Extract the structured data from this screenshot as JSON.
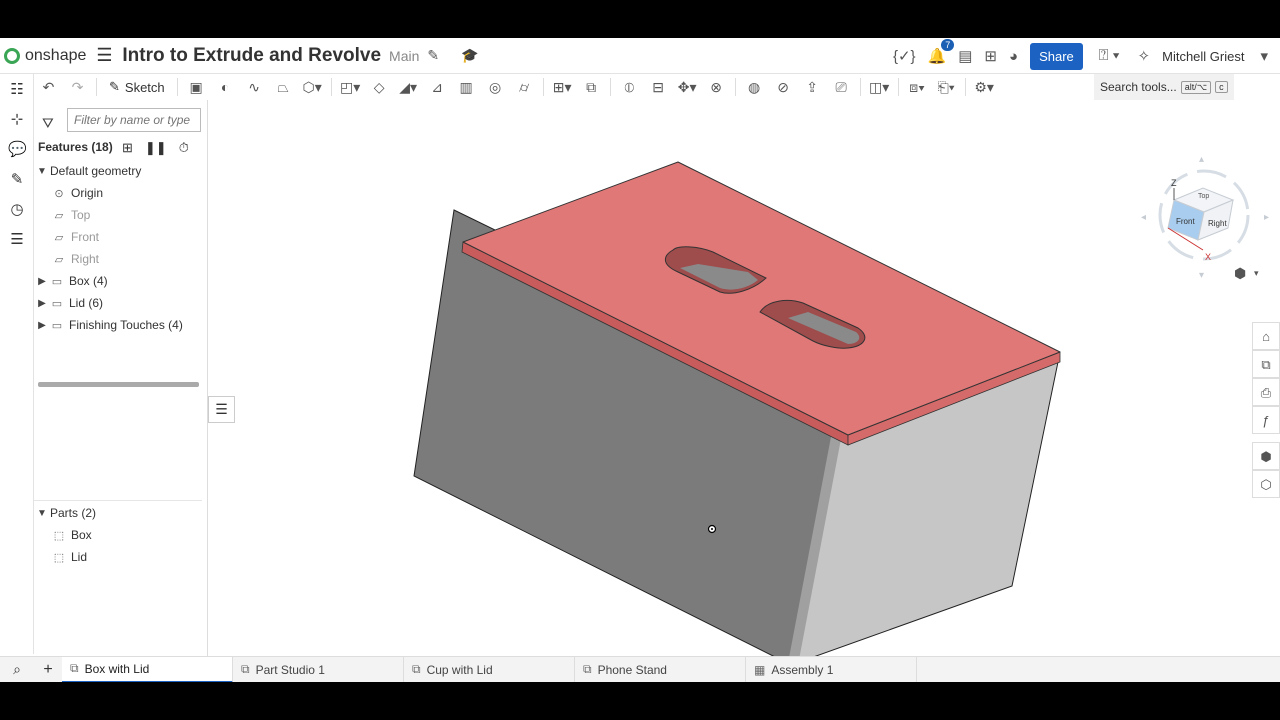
{
  "header": {
    "app_name": "onshape",
    "document_title": "Intro to Extrude and Revolve",
    "branch": "Main",
    "notification_count": "7",
    "share_label": "Share",
    "help_label": "?",
    "user_name": "Mitchell Griest"
  },
  "toolbar": {
    "sketch_label": "Sketch",
    "search_label": "Search tools...",
    "shortcut_modifier": "alt/⌥",
    "shortcut_key": "c"
  },
  "feature_panel": {
    "filter_placeholder": "Filter by name or type",
    "features_header": "Features (18)",
    "tree": [
      {
        "label": "Default geometry",
        "type": "group-open"
      },
      {
        "label": "Origin",
        "type": "origin"
      },
      {
        "label": "Top",
        "type": "plane"
      },
      {
        "label": "Front",
        "type": "plane"
      },
      {
        "label": "Right",
        "type": "plane"
      },
      {
        "label": "Box (4)",
        "type": "folder"
      },
      {
        "label": "Lid (6)",
        "type": "folder"
      },
      {
        "label": "Finishing Touches (4)",
        "type": "folder"
      }
    ],
    "parts_header": "Parts (2)",
    "parts": [
      "Box",
      "Lid"
    ]
  },
  "view_cube": {
    "top_label": "Top",
    "front_label": "Front",
    "right_label": "Right",
    "axis_x": "X",
    "axis_z": "Z"
  },
  "tabs": [
    {
      "label": "Box with Lid",
      "active": true,
      "icon": "part-studio-icon"
    },
    {
      "label": "Part Studio 1",
      "active": false,
      "icon": "part-studio-icon"
    },
    {
      "label": "Cup with Lid",
      "active": false,
      "icon": "part-studio-icon"
    },
    {
      "label": "Phone Stand",
      "active": false,
      "icon": "part-studio-icon"
    },
    {
      "label": "Assembly 1",
      "active": false,
      "icon": "assembly-icon"
    }
  ],
  "colors": {
    "lid_face": "#e07878",
    "box_front": "#7a7a7a",
    "box_side": "#c4c4c4",
    "accent": "#1b62c2"
  }
}
